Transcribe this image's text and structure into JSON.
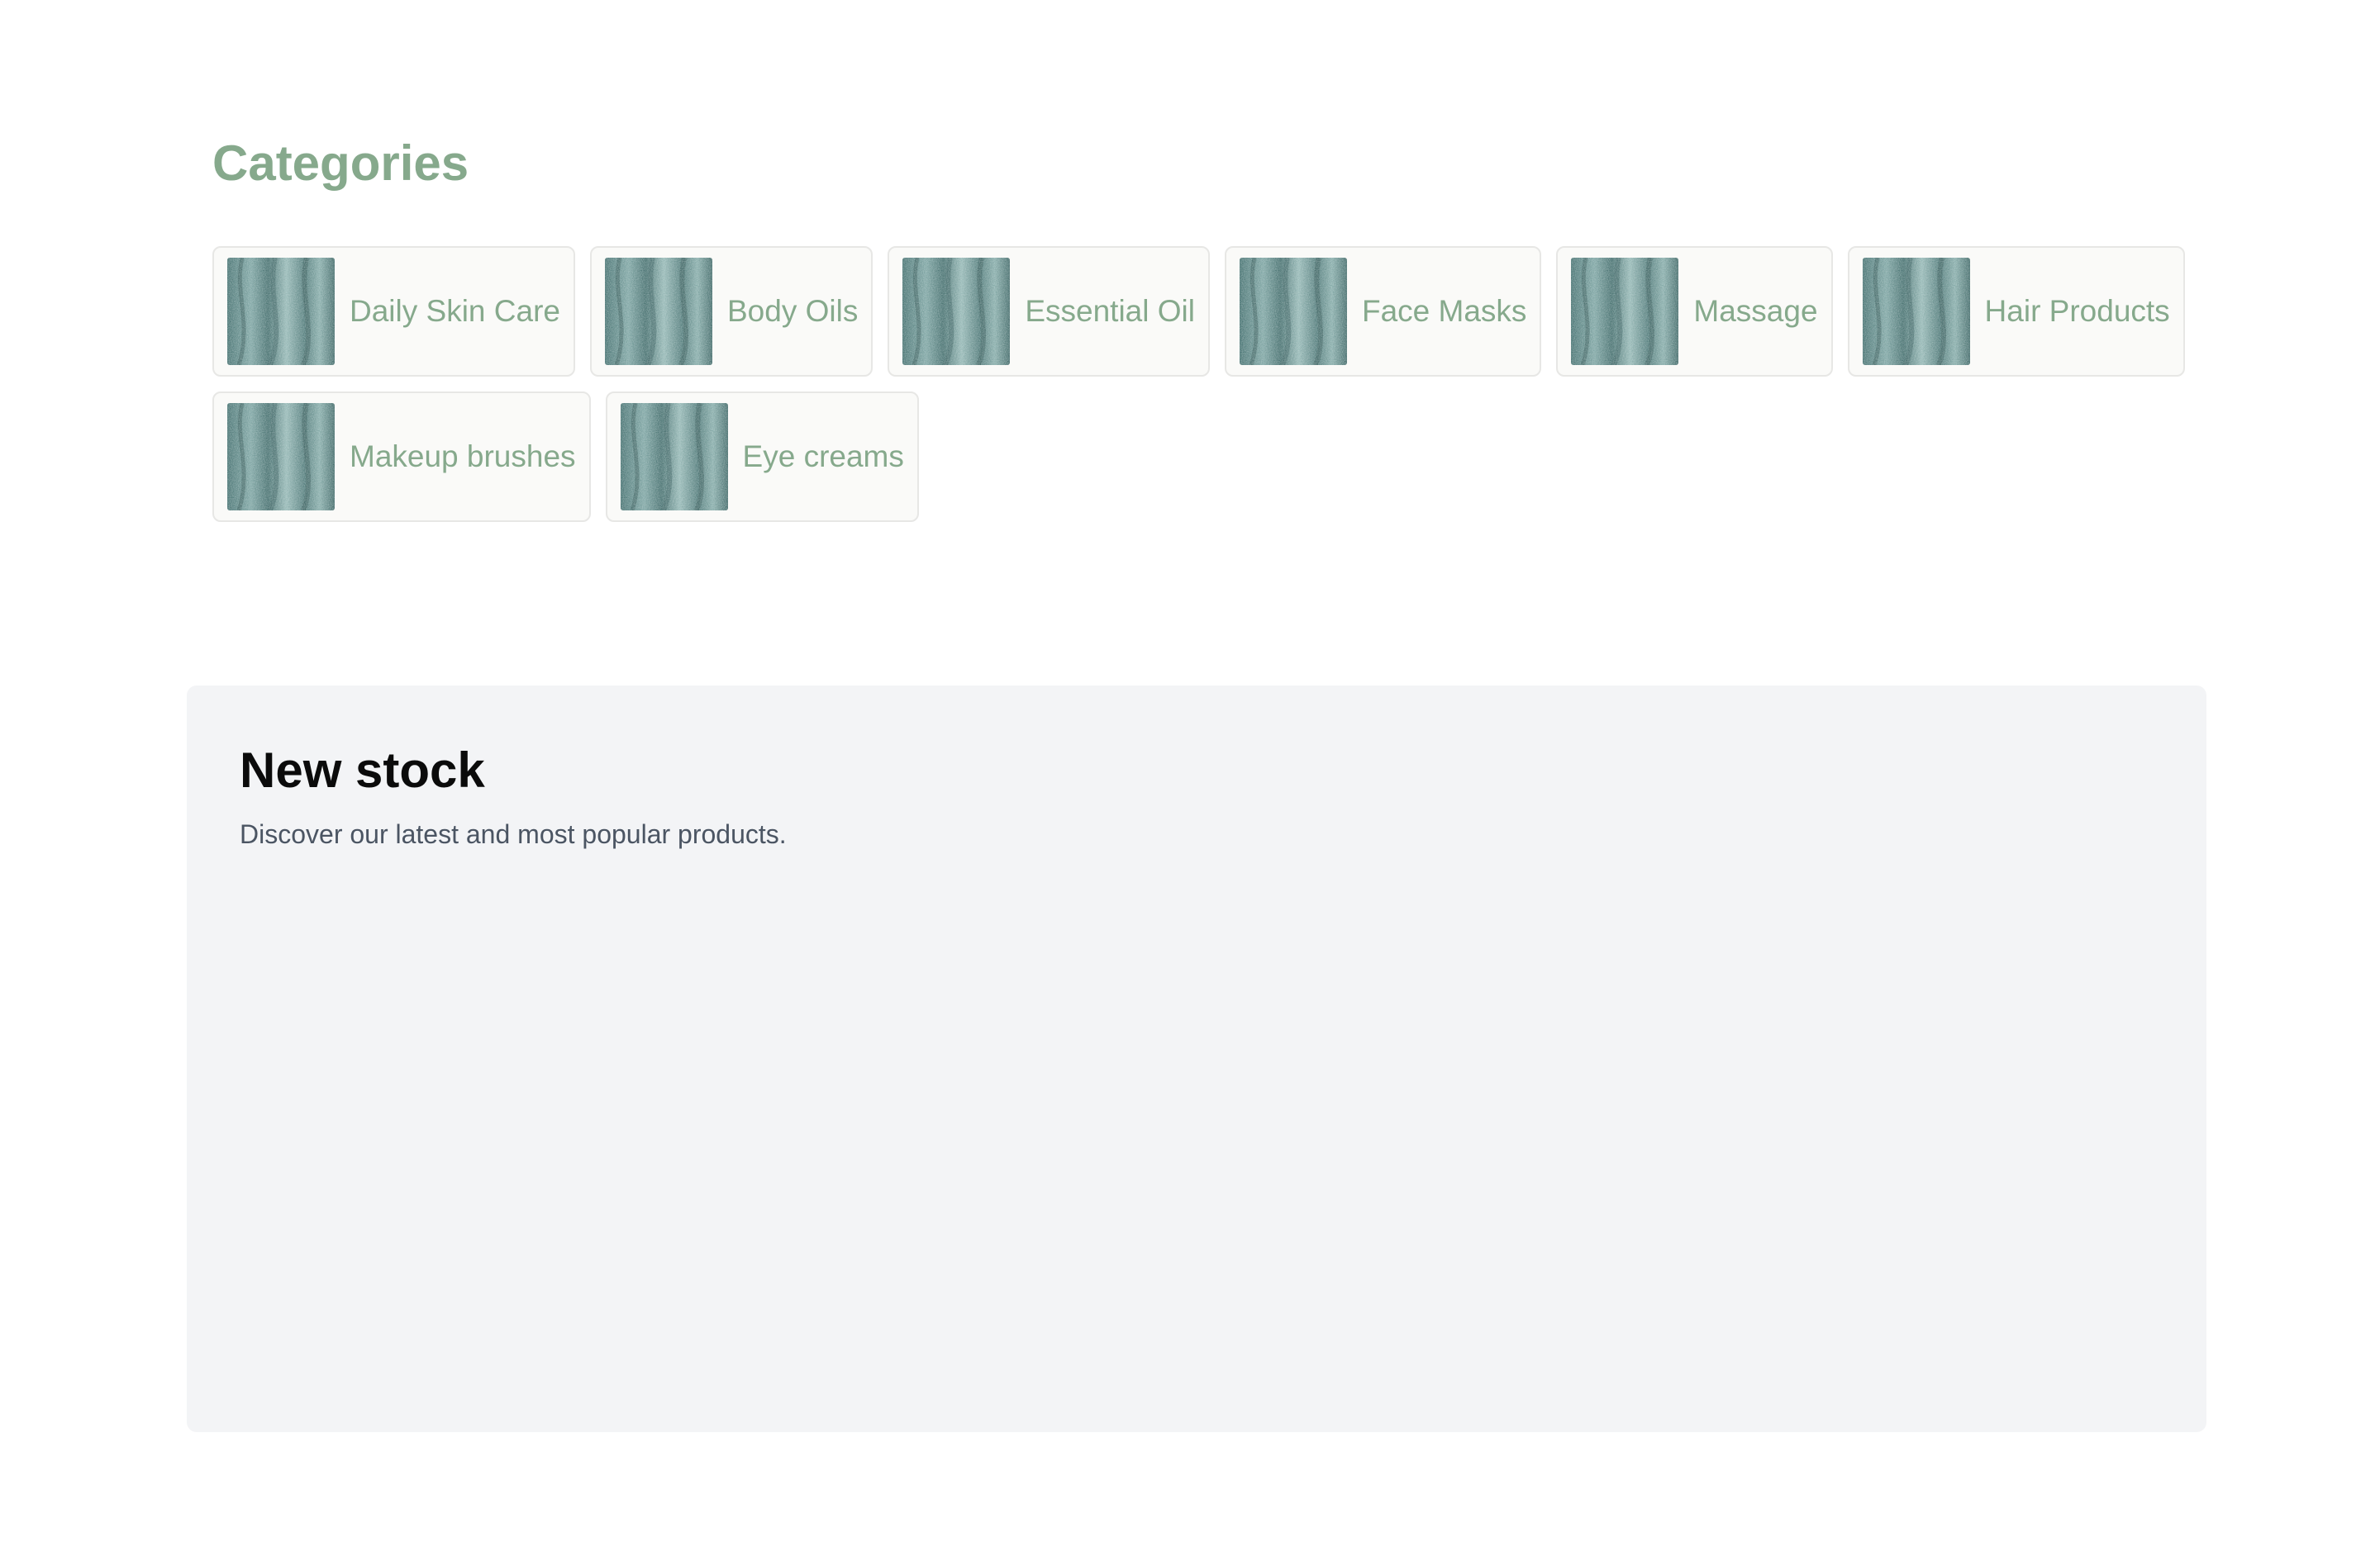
{
  "categories": {
    "title": "Categories",
    "items": [
      {
        "label": "Daily Skin Care"
      },
      {
        "label": "Body Oils"
      },
      {
        "label": "Essential Oil"
      },
      {
        "label": "Face Masks"
      },
      {
        "label": "Massage"
      },
      {
        "label": "Hair Products"
      },
      {
        "label": "Makeup brushes"
      },
      {
        "label": "Eye creams"
      }
    ]
  },
  "new_stock": {
    "title": "New stock",
    "subtitle": "Discover our latest and most popular products."
  },
  "colors": {
    "accent": "#86a98c",
    "card_background": "#fafaf8",
    "card_border": "#e7e7e5",
    "panel_background": "#f3f4f6",
    "heading": "#0b0b0b",
    "body_text": "#4b5563"
  }
}
